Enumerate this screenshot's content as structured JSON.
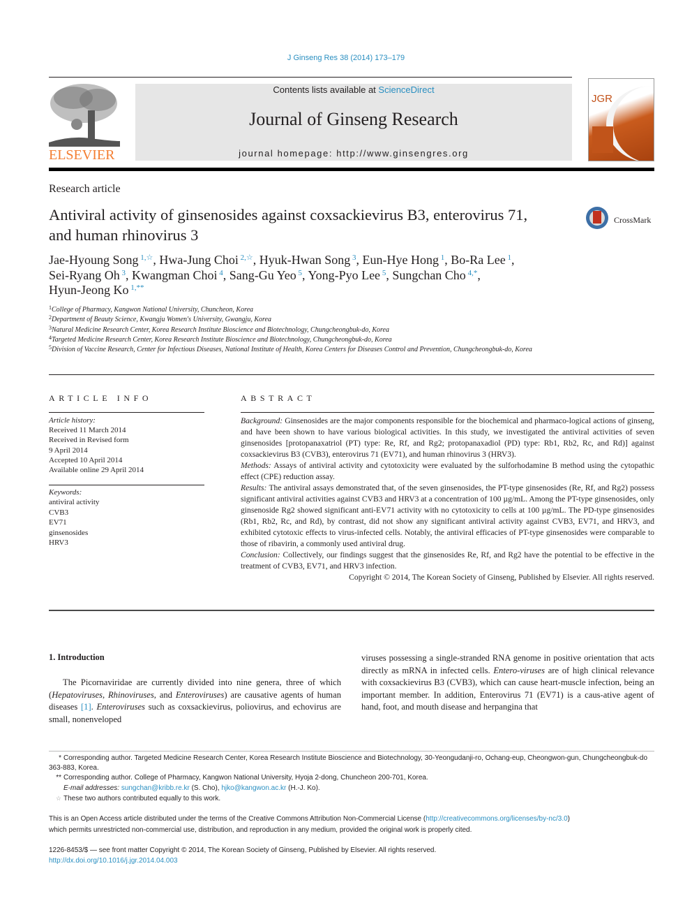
{
  "header": {
    "journal_ref": "J Ginseng Res 38 (2014) 173–179",
    "contents_prefix": "Contents lists available at ",
    "contents_link": "ScienceDirect",
    "journal_title": "Journal of Ginseng Research",
    "homepage_label": "journal homepage: http://www.ginsengres.org",
    "publisher_logo_text": "ELSEVIER",
    "cover_text": "JGR",
    "brand_color": "#f47d30",
    "link_color": "#2a8fc1"
  },
  "article": {
    "type": "Research article",
    "title": "Antiviral activity of ginsenosides against coxsackievirus B3, enterovirus 71, and human rhinovirus 3",
    "crossmark_label": "CrossMark",
    "authors": [
      {
        "name": "Jae-Hyoung Song",
        "sup": "1,☆",
        "sep": ", "
      },
      {
        "name": "Hwa-Jung Choi",
        "sup": "2,☆",
        "sep": ", "
      },
      {
        "name": "Hyuk-Hwan Song",
        "sup": "3",
        "sep": ", "
      },
      {
        "name": "Eun-Hye Hong",
        "sup": "1",
        "sep": ", "
      },
      {
        "name": "Bo-Ra Lee",
        "sup": "1",
        "sep": ","
      },
      {
        "name": "Sei-Ryang Oh",
        "sup": "3",
        "sep": ", "
      },
      {
        "name": "Kwangman Choi",
        "sup": "4",
        "sep": ", "
      },
      {
        "name": "Sang-Gu Yeo",
        "sup": "5",
        "sep": ", "
      },
      {
        "name": "Yong-Pyo Lee",
        "sup": "5",
        "sep": ", "
      },
      {
        "name": "Sungchan Cho",
        "sup": "4,*",
        "sep": ","
      },
      {
        "name": "Hyun-Jeong Ko",
        "sup": "1,**",
        "sep": ""
      }
    ],
    "affiliations": [
      {
        "num": "1",
        "text": "College of Pharmacy, Kangwon National University, Chuncheon, Korea"
      },
      {
        "num": "2",
        "text": "Department of Beauty Science, Kwangju Women's University, Gwangju, Korea"
      },
      {
        "num": "3",
        "text": "Natural Medicine Research Center, Korea Research Institute Bioscience and Biotechnology, Chungcheongbuk-do, Korea"
      },
      {
        "num": "4",
        "text": "Targeted Medicine Research Center, Korea Research Institute Bioscience and Biotechnology, Chungcheongbuk-do, Korea"
      },
      {
        "num": "5",
        "text": "Division of Vaccine Research, Center for Infectious Diseases, National Institute of Health, Korea Centers for Diseases Control and Prevention, Chungcheongbuk-do, Korea"
      }
    ]
  },
  "article_info": {
    "heading": "ARTICLE INFO",
    "history_label": "Article history:",
    "history": [
      "Received 11 March 2014",
      "Received in Revised form",
      "9 April 2014",
      "Accepted 10 April 2014",
      "Available online 29 April 2014"
    ],
    "keywords_label": "Keywords:",
    "keywords": [
      "antiviral activity",
      "CVB3",
      "EV71",
      "ginsenosides",
      "HRV3"
    ]
  },
  "abstract": {
    "heading": "ABSTRACT",
    "sections": [
      {
        "label": "Background:",
        "text": " Ginsenosides are the major components responsible for the biochemical and pharmaco-logical actions of ginseng, and have been shown to have various biological activities. In this study, we investigated the antiviral activities of seven ginsenosides [protopanaxatriol (PT) type: Re, Rf, and Rg2; protopanaxadiol (PD) type: Rb1, Rb2, Rc, and Rd)] against coxsackievirus B3 (CVB3), enterovirus 71 (EV71), and human rhinovirus 3 (HRV3)."
      },
      {
        "label": "Methods:",
        "text": " Assays of antiviral activity and cytotoxicity were evaluated by the sulforhodamine B method using the cytopathic effect (CPE) reduction assay."
      },
      {
        "label": "Results:",
        "text": " The antiviral assays demonstrated that, of the seven ginsenosides, the PT-type ginsenosides (Re, Rf, and Rg2) possess significant antiviral activities against CVB3 and HRV3 at a concentration of 100 µg/mL. Among the PT-type ginsenosides, only ginsenoside Rg2 showed significant anti-EV71 activity with no cytotoxicity to cells at 100 µg/mL. The PD-type ginsenosides (Rb1, Rb2, Rc, and Rd), by contrast, did not show any significant antiviral activity against CVB3, EV71, and HRV3, and exhibited cytotoxic effects to virus-infected cells. Notably, the antiviral efficacies of PT-type ginsenosides were comparable to those of ribavirin, a commonly used antiviral drug."
      },
      {
        "label": "Conclusion:",
        "text": " Collectively, our findings suggest that the ginsenosides Re, Rf, and Rg2 have the potential to be effective in the treatment of CVB3, EV71, and HRV3 infection."
      }
    ],
    "copyright": "Copyright © 2014, The Korean Society of Ginseng, Published by Elsevier. All rights reserved."
  },
  "introduction": {
    "heading": "1.  Introduction",
    "col1_parts": [
      {
        "t": "The Picornaviridae are currently divided into nine genera, three of which (",
        "s": ""
      },
      {
        "t": "Hepatoviruses",
        "s": "i"
      },
      {
        "t": ", ",
        "s": ""
      },
      {
        "t": "Rhinoviruses",
        "s": "i"
      },
      {
        "t": ", and ",
        "s": ""
      },
      {
        "t": "Enteroviruses",
        "s": "i"
      },
      {
        "t": ") are causative agents of human diseases ",
        "s": ""
      },
      {
        "t": "[1]",
        "s": "link"
      },
      {
        "t": ". ",
        "s": ""
      },
      {
        "t": "Enteroviruses",
        "s": "i"
      },
      {
        "t": " such as coxsackievirus, poliovirus, and echovirus are small, nonenveloped",
        "s": ""
      }
    ],
    "col2_parts": [
      {
        "t": "viruses possessing a single-stranded RNA genome in positive orientation that acts directly as mRNA in infected cells. ",
        "s": ""
      },
      {
        "t": "Entero-viruses",
        "s": "i"
      },
      {
        "t": " are of high clinical relevance with coxsackievirus B3 (CVB3), which can cause heart-muscle infection, being an important member. In addition, Enterovirus 71 (EV71) is a caus-ative agent of hand, foot, and mouth disease and herpangina that",
        "s": ""
      }
    ]
  },
  "footnotes": {
    "corr1_mark": "*",
    "corr1_text": "Corresponding author. Targeted Medicine Research Center, Korea Research Institute Bioscience and Biotechnology, 30-Yeongudanji-ro, Ochang-eup, Cheongwon-gun, Chungcheongbuk-do 363-883, Korea.",
    "corr2_mark": "**",
    "corr2_text": "Corresponding author. College of Pharmacy, Kangwon National University, Hyoja 2-dong, Chuncheon 200-701, Korea.",
    "email_label": "E-mail addresses:",
    "email1": "sungchan@kribb.re.kr",
    "email1_who": " (S. Cho), ",
    "email2": "hjko@kangwon.ac.kr",
    "email2_who": " (H.-J. Ko).",
    "equal_mark": "☆",
    "equal_text": "These two authors contributed equally to this work."
  },
  "license": {
    "text1": "This is an Open Access article distributed under the terms of the Creative Commons Attribution Non-Commercial License (",
    "url": "http://creativecommons.org/licenses/by-nc/3.0",
    "text2": ")",
    "text3": "which permits unrestricted non-commercial use, distribution, and reproduction in any medium, provided the original work is properly cited."
  },
  "issn": {
    "line": "1226-8453/$ — see front matter Copyright © 2014, The Korean Society of Ginseng, Published by Elsevier. All rights reserved.",
    "doi": "http://dx.doi.org/10.1016/j.jgr.2014.04.003"
  }
}
